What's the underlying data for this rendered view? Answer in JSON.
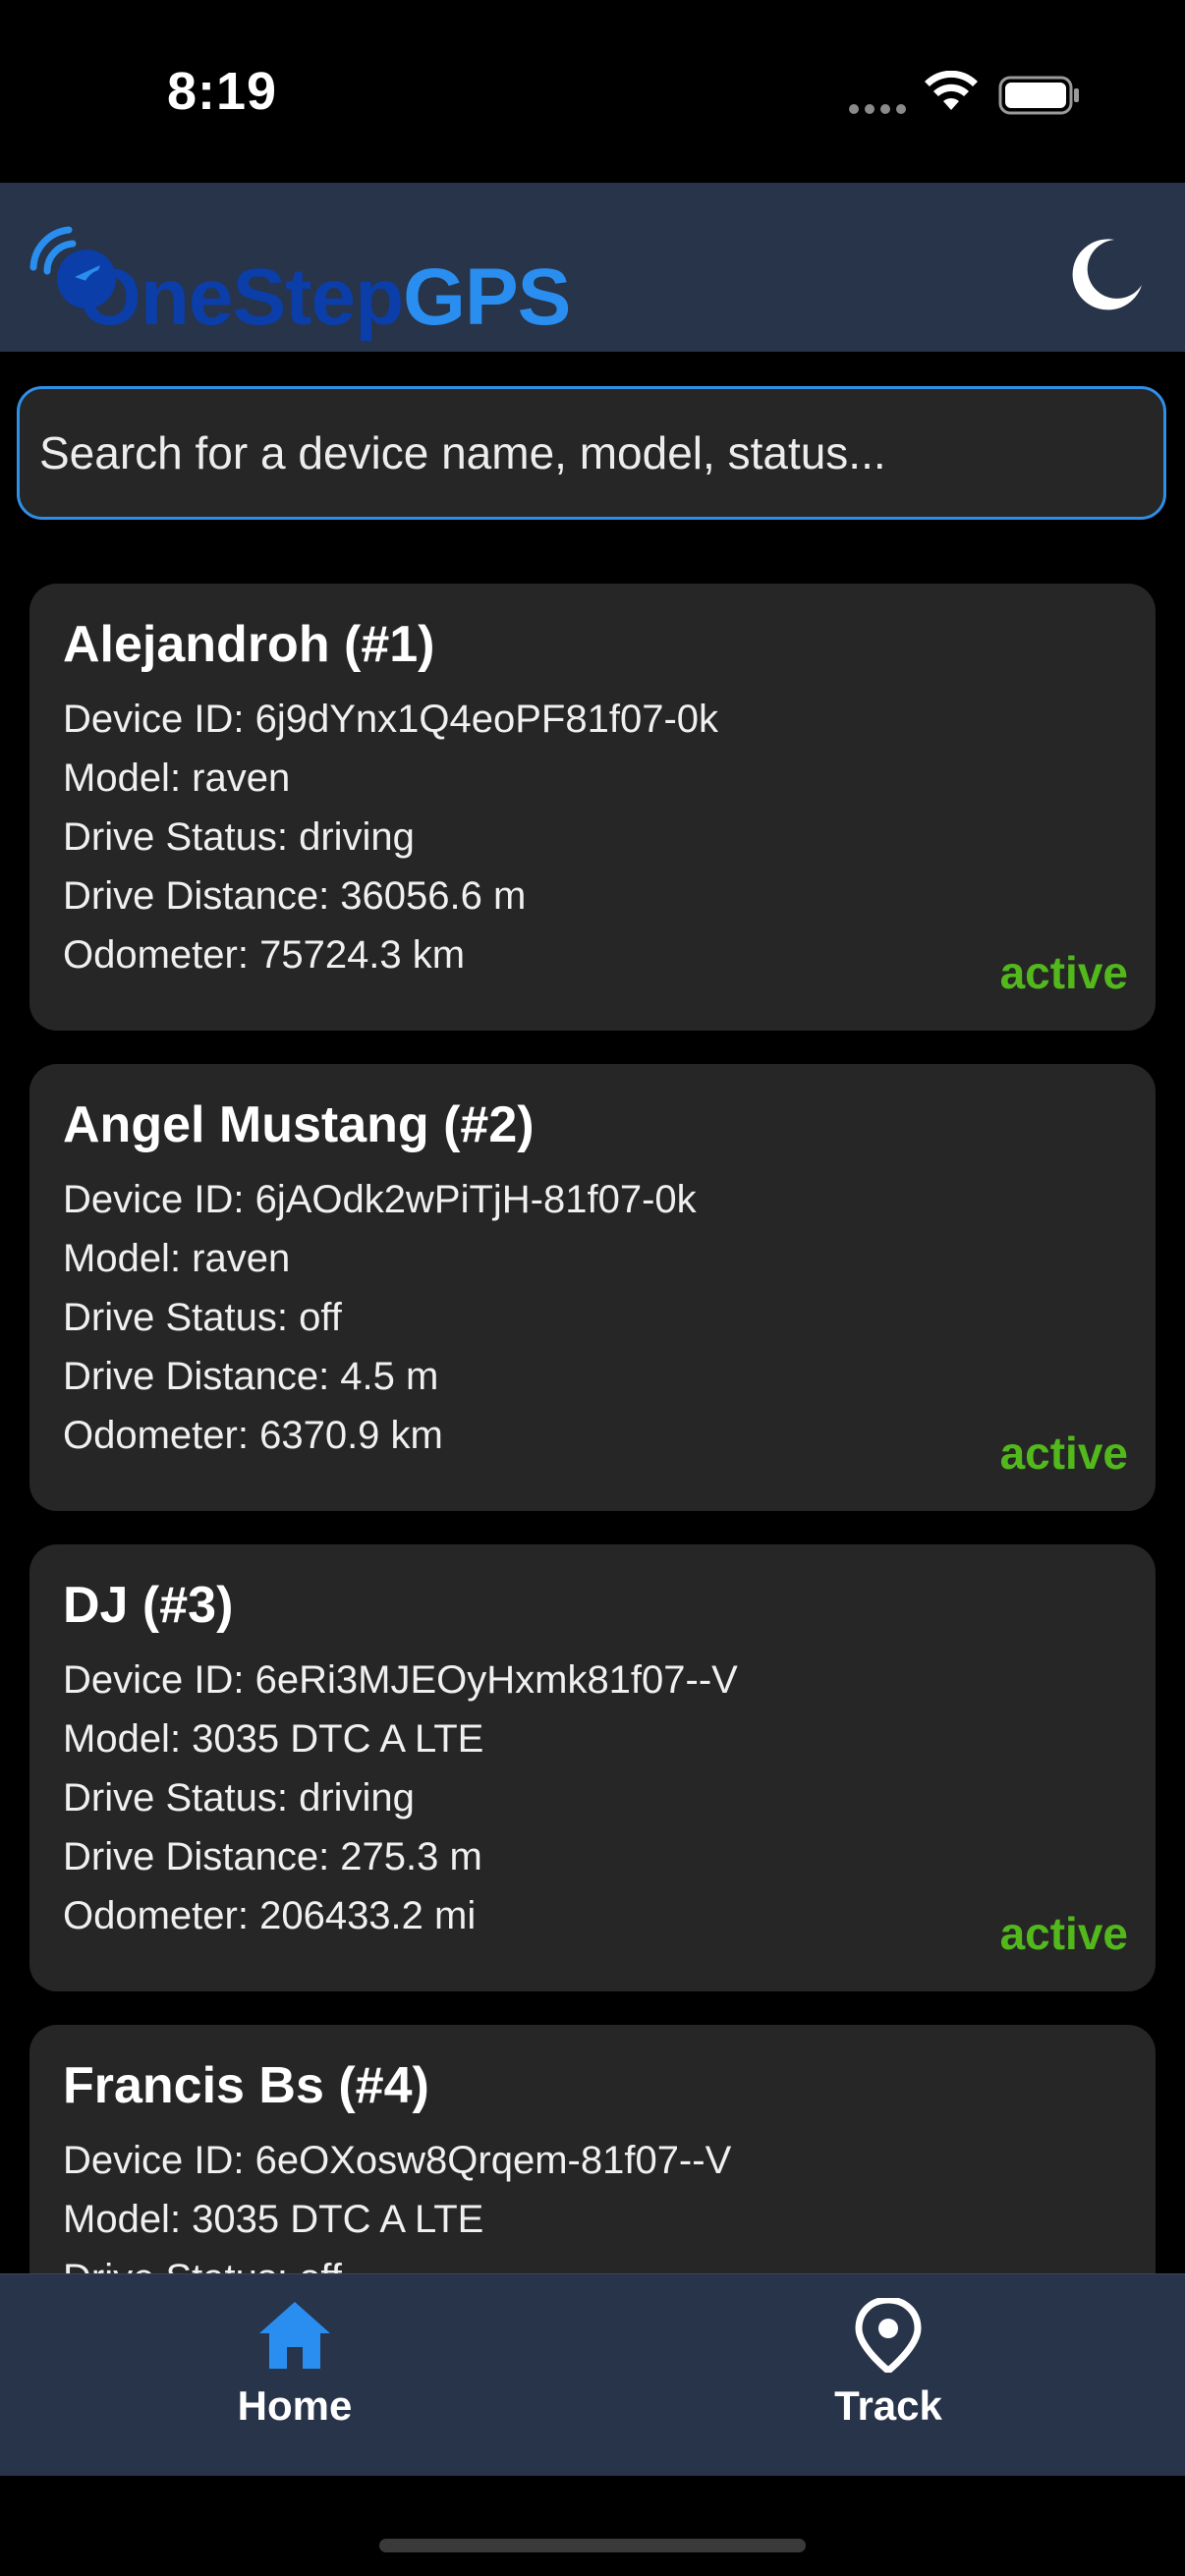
{
  "status_bar": {
    "time": "8:19",
    "icons": [
      "signal-dots-icon",
      "wifi-icon",
      "battery-icon"
    ]
  },
  "header": {
    "logo_part_one": "OneStep",
    "logo_part_two": "GPS",
    "logo_colors": {
      "one": "#0b3ea8",
      "two": "#2a8ef0"
    },
    "theme_toggle_icon": "moon-icon",
    "background": "#273449"
  },
  "search": {
    "placeholder": "Search for a device name, model, status...",
    "value": "",
    "border_color": "#2f8fe6"
  },
  "devices": [
    {
      "title": "Alejandroh (#1)",
      "device_id": "Device ID: 6j9dYnx1Q4eoPF81f07-0k",
      "model": "Model: raven",
      "drive_status": "Drive Status: driving",
      "drive_distance": "Drive Distance: 36056.6 m",
      "odometer": "Odometer: 75724.3 km",
      "status": "active"
    },
    {
      "title": "Angel Mustang (#2)",
      "device_id": "Device ID: 6jAOdk2wPiTjH-81f07-0k",
      "model": "Model: raven",
      "drive_status": "Drive Status: off",
      "drive_distance": "Drive Distance: 4.5 m",
      "odometer": "Odometer: 6370.9 km",
      "status": "active"
    },
    {
      "title": "DJ (#3)",
      "device_id": "Device ID: 6eRi3MJEOyHxmk81f07--V",
      "model": "Model: 3035 DTC A LTE",
      "drive_status": "Drive Status: driving",
      "drive_distance": "Drive Distance: 275.3 m",
      "odometer": "Odometer: 206433.2 mi",
      "status": "active"
    },
    {
      "title": "Francis Bs (#4)",
      "device_id": "Device ID: 6eOXosw8Qrqem-81f07--V",
      "model": "Model: 3035 DTC A LTE",
      "drive_status": "Drive Status: off",
      "drive_distance": "",
      "odometer": "",
      "status": ""
    }
  ],
  "status_color": "#52b81c",
  "tab_bar": {
    "tabs": [
      {
        "label": "Home",
        "icon": "home-icon",
        "active": true,
        "icon_color": "#2a8ef0"
      },
      {
        "label": "Track",
        "icon": "map-pin-icon",
        "active": false,
        "icon_color": "#ffffff"
      }
    ]
  }
}
